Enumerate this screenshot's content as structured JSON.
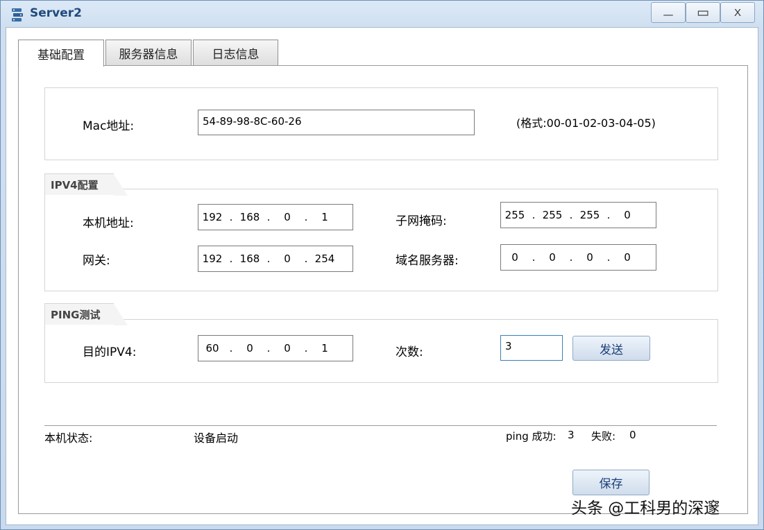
{
  "window": {
    "title": "Server2",
    "minimize_label": "—",
    "maximize_label": "▭",
    "close_label": "X"
  },
  "tabs": [
    {
      "label": "基础配置",
      "active": true
    },
    {
      "label": "服务器信息",
      "active": false
    },
    {
      "label": "日志信息",
      "active": false
    }
  ],
  "mac": {
    "label": "Mac地址:",
    "value": "54-89-98-8C-60-26",
    "format_hint": "(格式:00-01-02-03-04-05)"
  },
  "ipv4": {
    "legend": "IPV4配置",
    "local_address_label": "本机地址:",
    "local_address": [
      "192",
      "168",
      "0",
      "1"
    ],
    "subnet_mask_label": "子网掩码:",
    "subnet_mask": [
      "255",
      "255",
      "255",
      "0"
    ],
    "gateway_label": "网关:",
    "gateway": [
      "192",
      "168",
      "0",
      "254"
    ],
    "dns_label": "域名服务器:",
    "dns": [
      "0",
      "0",
      "0",
      "0"
    ]
  },
  "ping": {
    "legend": "PING测试",
    "target_label": "目的IPV4:",
    "target": [
      "60",
      "0",
      "0",
      "1"
    ],
    "count_label": "次数:",
    "count_value": "3",
    "send_label": "发送"
  },
  "status": {
    "label": "本机状态:",
    "value": "设备启动",
    "ping_success_label": "ping 成功:",
    "ping_success": "3",
    "fail_label": "失败:",
    "fail": "0"
  },
  "save_label": "保存",
  "watermark": "头条 @工科男的深邃",
  "colors": {
    "title_text": "#1f4a7a",
    "button_text": "#1b3f78",
    "focus_border": "#3c7fb1"
  }
}
